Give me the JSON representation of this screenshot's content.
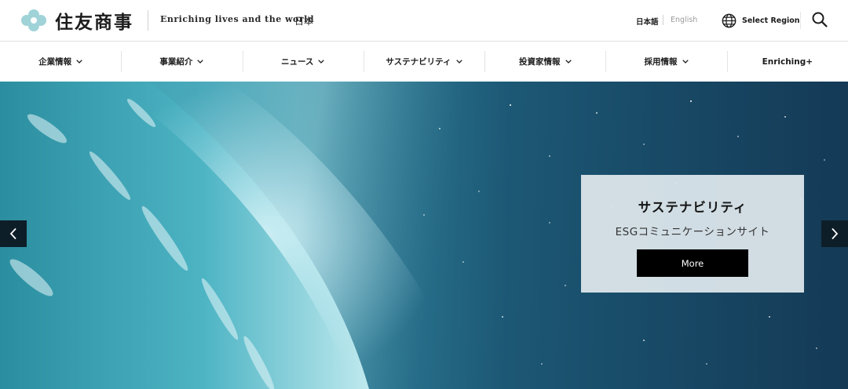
{
  "header": {
    "logo_text": "住友商事",
    "tagline": "Enriching lives and the world",
    "country": "日本",
    "lang_ja": "日本語",
    "lang_en": "English",
    "region_label": "Select Region"
  },
  "nav": {
    "items": [
      {
        "label": "企業情報",
        "has_dropdown": true
      },
      {
        "label": "事業紹介",
        "has_dropdown": true
      },
      {
        "label": "ニュース",
        "has_dropdown": true
      },
      {
        "label": "サステナビリティ",
        "has_dropdown": true
      },
      {
        "label": "投資家情報",
        "has_dropdown": true
      },
      {
        "label": "採用情報",
        "has_dropdown": true
      },
      {
        "label": "Enriching+",
        "has_dropdown": false
      }
    ]
  },
  "hero": {
    "promo_title": "サステナビリティ",
    "promo_subtitle": "ESGコミュニケーションサイト",
    "promo_button": "More"
  },
  "colors": {
    "logo_mark": "#9fd3d8",
    "text_primary": "#1c1c1c",
    "button_bg": "#000000",
    "arrow_bg": "#0e1e28",
    "panel_bg": "#e2eaef"
  },
  "icons": {
    "logo": "logo-mark-icon",
    "region": "globe-icon",
    "search": "search-icon",
    "prev": "chevron-left-icon",
    "next": "chevron-right-icon",
    "dropdown": "chevron-down-icon"
  }
}
